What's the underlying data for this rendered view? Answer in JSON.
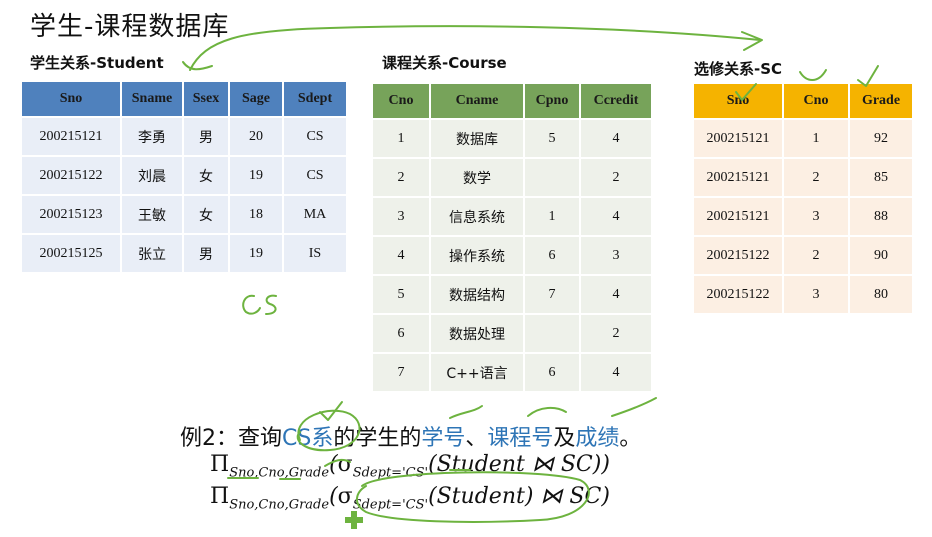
{
  "title": "学生-课程数据库",
  "student": {
    "caption": "学生关系-Student",
    "headers": [
      "Sno",
      "Sname",
      "Ssex",
      "Sage",
      "Sdept"
    ],
    "rows": [
      [
        "200215121",
        "李勇",
        "男",
        "20",
        "CS"
      ],
      [
        "200215122",
        "刘晨",
        "女",
        "19",
        "CS"
      ],
      [
        "200215123",
        "王敏",
        "女",
        "18",
        "MA"
      ],
      [
        "200215125",
        "张立",
        "男",
        "19",
        "IS"
      ]
    ]
  },
  "course": {
    "caption": "课程关系-Course",
    "headers": [
      "Cno",
      "Cname",
      "Cpno",
      "Ccredit"
    ],
    "rows": [
      [
        "1",
        "数据库",
        "5",
        "4"
      ],
      [
        "2",
        "数学",
        "",
        "2"
      ],
      [
        "3",
        "信息系统",
        "1",
        "4"
      ],
      [
        "4",
        "操作系统",
        "6",
        "3"
      ],
      [
        "5",
        "数据结构",
        "7",
        "4"
      ],
      [
        "6",
        "数据处理",
        "",
        "2"
      ],
      [
        "7",
        "C++语言",
        "6",
        "4"
      ]
    ]
  },
  "sc": {
    "caption": "选修关系-SC",
    "headers": [
      "Sno",
      "Cno",
      "Grade"
    ],
    "rows": [
      [
        "200215121",
        "1",
        "92"
      ],
      [
        "200215121",
        "2",
        "85"
      ],
      [
        "200215121",
        "3",
        "88"
      ],
      [
        "200215122",
        "2",
        "90"
      ],
      [
        "200215122",
        "3",
        "80"
      ]
    ]
  },
  "handwriting": {
    "cs_note": "CS"
  },
  "example": {
    "prefix": "例2：查询",
    "cs_dept": "CS系",
    "mid": "的学生的",
    "sno": "学号",
    "sep": "、",
    "cno": "课程号",
    "and": "及",
    "grade": "成绩",
    "end": "。"
  },
  "formulas": {
    "pi": "Π",
    "proj_attrs": "Sno,Cno,Grade",
    "sigma": "σ",
    "sel_cond": "Sdept='CS'",
    "f1_body": "(Student ⋈ SC))",
    "f2_body": "(Student) ⋈ SC)",
    "open": "(",
    "open2": "("
  },
  "colors": {
    "student_header": "#4f81bd",
    "course_header": "#77a35a",
    "sc_header": "#f5b300",
    "highlight_text": "#2e75b6",
    "ink": "#6db33f"
  }
}
